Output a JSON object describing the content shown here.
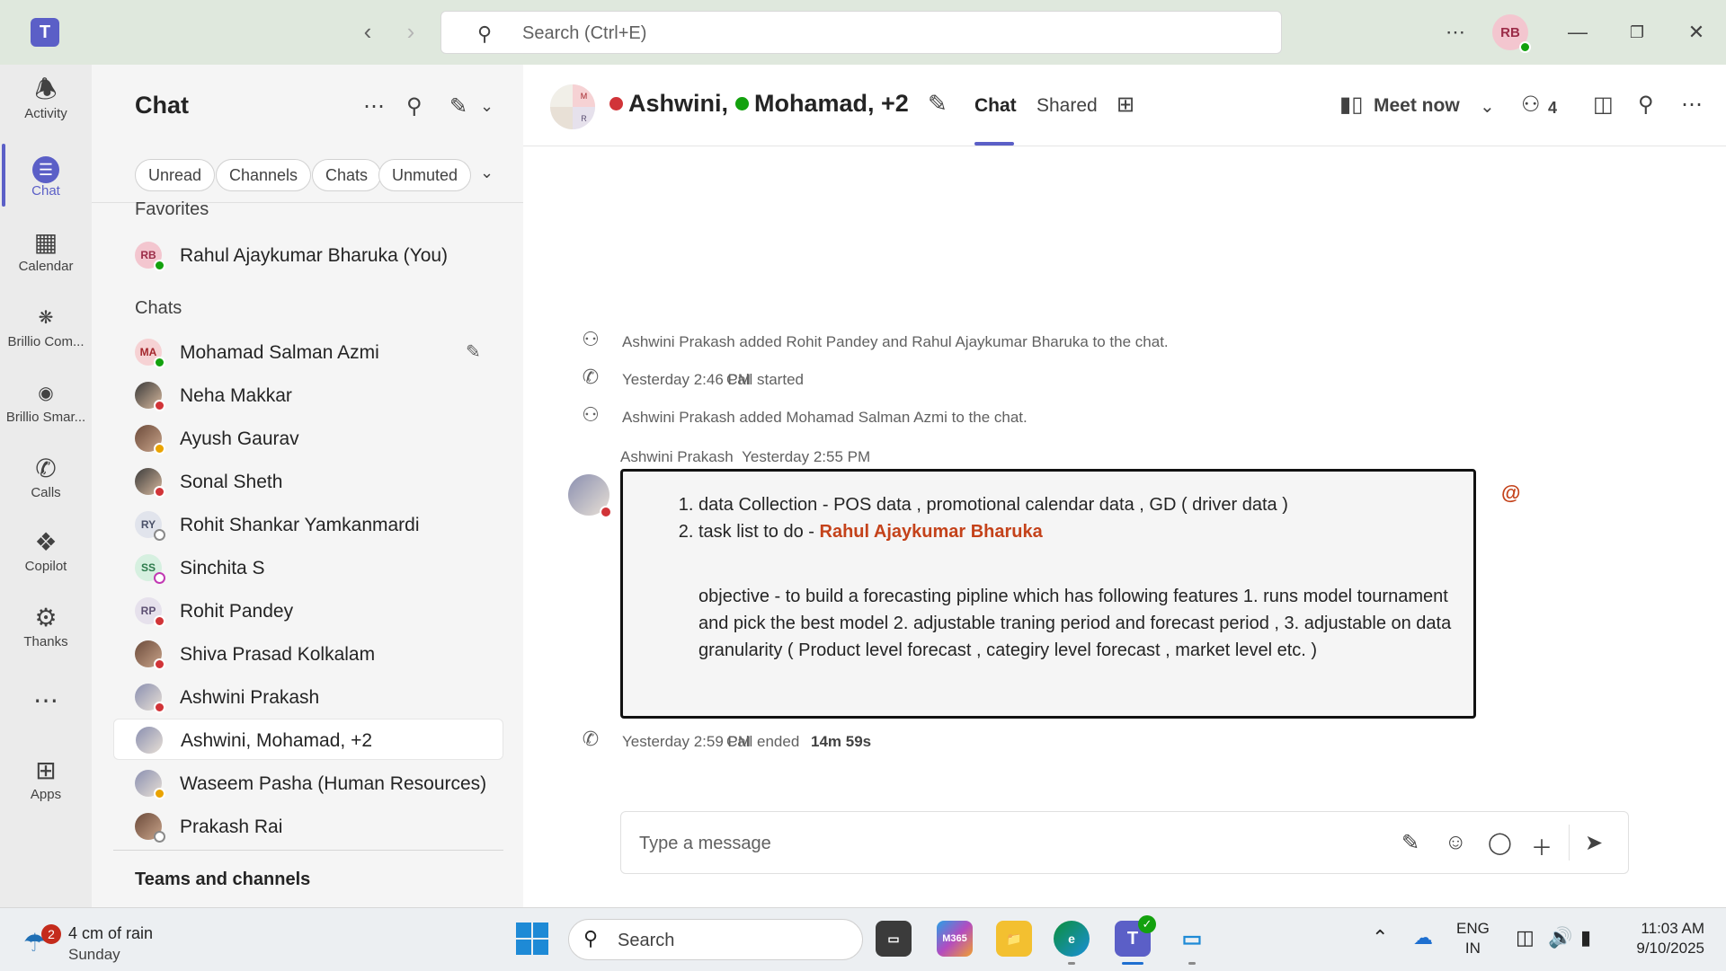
{
  "titlebar": {
    "search_placeholder": "Search (Ctrl+E)",
    "avatar_initials": "RB"
  },
  "rail": {
    "items": [
      {
        "label": "Activity"
      },
      {
        "label": "Chat"
      },
      {
        "label": "Calendar"
      },
      {
        "label": "Brillio Com..."
      },
      {
        "label": "Brillio Smar..."
      },
      {
        "label": "Calls"
      },
      {
        "label": "Copilot"
      },
      {
        "label": "Thanks"
      },
      {
        "label": "Apps"
      }
    ]
  },
  "list": {
    "title": "Chat",
    "filters": [
      "Unread",
      "Channels",
      "Chats",
      "Unmuted"
    ],
    "favorites_label": "Favorites",
    "favorites": [
      {
        "name": "Rahul Ajaykumar Bharuka (You)",
        "initials": "RB"
      }
    ],
    "chats_label": "Chats",
    "chats": [
      {
        "name": "Mohamad Salman Azmi",
        "initials": "MA"
      },
      {
        "name": "Neha Makkar",
        "initials": ""
      },
      {
        "name": "Ayush Gaurav",
        "initials": ""
      },
      {
        "name": "Sonal Sheth",
        "initials": ""
      },
      {
        "name": "Rohit Shankar Yamkanmardi",
        "initials": "RY"
      },
      {
        "name": "Sinchita S",
        "initials": "SS"
      },
      {
        "name": "Rohit Pandey",
        "initials": "RP"
      },
      {
        "name": "Shiva Prasad Kolkalam",
        "initials": ""
      },
      {
        "name": "Ashwini Prakash",
        "initials": ""
      },
      {
        "name": "Ashwini, Mohamad, +2",
        "initials": ""
      },
      {
        "name": "Waseem Pasha (Human Resources)",
        "initials": ""
      },
      {
        "name": "Prakash Rai",
        "initials": ""
      }
    ],
    "teams_label": "Teams and channels"
  },
  "header": {
    "name1": "Ashwini,",
    "name2": "Mohamad",
    "more": ", +2",
    "tab_chat": "Chat",
    "tab_shared": "Shared",
    "meet_now": "Meet now",
    "participants_count": "4",
    "group_avatar_letters": [
      "M",
      "R"
    ]
  },
  "messages": {
    "system1": "Ashwini Prakash added Rohit Pandey and Rahul Ajaykumar Bharuka to the chat.",
    "call_start_time": "Yesterday 2:46 PM",
    "call_start_text": "Call started",
    "system2": "Ashwini Prakash added Mohamad Salman Azmi to the chat.",
    "sender": "Ashwini Prakash",
    "sent_time": "Yesterday 2:55 PM",
    "item1": "data Collection - POS data , promotional calendar data , GD ( driver data )",
    "item2_prefix": "task list to do - ",
    "item2_mention": "Rahul Ajaykumar Bharuka",
    "objective": "objective - to build a forecasting pipline which has following features 1. runs model tournament and pick the best model 2. adjustable traning period and forecast period , 3. adjustable on data granularity ( Product level forecast , categiry level forecast , market level etc. )",
    "mention_marker": "@",
    "call_end_time": "Yesterday 2:59 PM",
    "call_end_text": "Call ended",
    "call_duration": "14m 59s"
  },
  "composer": {
    "placeholder": "Type a message"
  },
  "taskbar": {
    "weather_badge": "2",
    "weather_line1": "4 cm of rain",
    "weather_line2": "Sunday",
    "search_label": "Search",
    "m365_label": "M365",
    "lang_line1": "ENG",
    "lang_line2": "IN",
    "time": "11:03 AM",
    "date": "9/10/2025"
  }
}
